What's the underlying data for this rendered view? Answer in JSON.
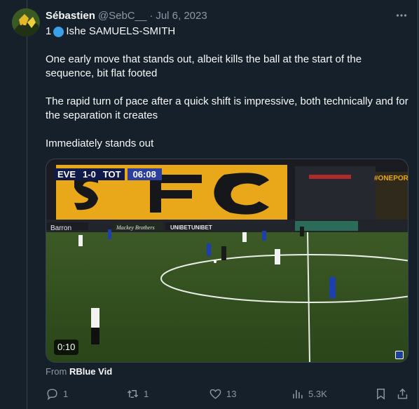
{
  "post": {
    "author": {
      "display_name": "Sébastien",
      "handle": "@SebC__",
      "separator": "·",
      "date": "Jul 6, 2023"
    },
    "more_icon": "more-horizontal-icon",
    "text": {
      "title_prefix": "1",
      "title_emoji": "blue-circle",
      "title_name": "Ishe SAMUELS-SMITH",
      "paragraphs": [
        "One early move that stands out, albeit kills the ball at the start of the sequence, bit flat footed",
        "The rapid turn of pace after a quick shift is impressive, both technically and for the separation it creates",
        "Immediately stands out"
      ]
    },
    "video": {
      "scorebug": {
        "home": "EVE",
        "score": "1-0",
        "away": "TOT",
        "clock": "06:08"
      },
      "duration": "0:10",
      "stand_lettering": "SFC",
      "ad_boards": [
        "Barron",
        "Mackey Brothers",
        "UNIBET",
        "UNIBET",
        "#ONEPOR"
      ]
    },
    "attribution": {
      "prefix": "From",
      "source": "RBlue Vid"
    },
    "actions": {
      "replies": "1",
      "reposts": "1",
      "likes": "13",
      "views": "5.3K"
    },
    "colors": {
      "background": "#15202b",
      "text": "#f7f9f9",
      "muted": "#8b98a5",
      "border": "#38444d"
    }
  }
}
